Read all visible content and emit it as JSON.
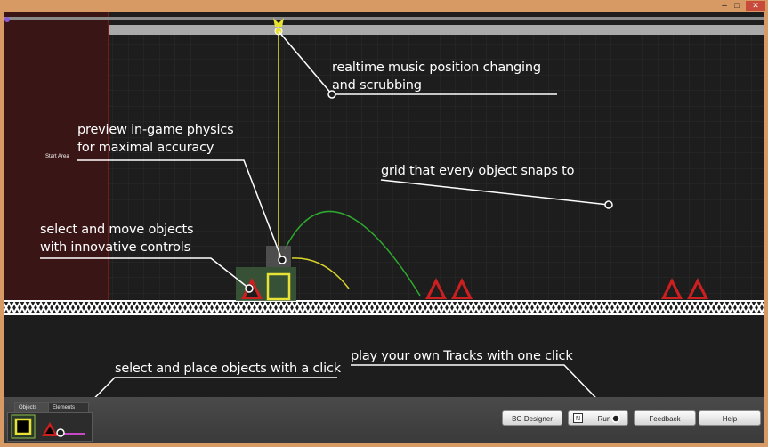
{
  "window": {
    "minimize_glyph": "–",
    "maximize_glyph": "□",
    "close_glyph": "✕"
  },
  "canvas": {
    "start_area_label": "Start Area",
    "annotations": {
      "music": "realtime music position changing\nand scrubbing",
      "physics": "preview in-game physics\nfor maximal accuracy",
      "grid": "grid that every object snaps to",
      "move": "select and move objects\nwith innovative controls",
      "place": "select and place objects with a click",
      "play": "play your own Tracks with one click"
    }
  },
  "bottombar": {
    "tabs": [
      {
        "label": "Objects"
      },
      {
        "label": "Elements"
      }
    ],
    "buttons": {
      "bg_designer": "BG Designer",
      "run": "Run",
      "feedback": "Feedback",
      "help": "Help"
    }
  },
  "colors": {
    "accent_yellow": "#e8e234",
    "spike_red": "#cc1f1f",
    "arc_green": "#2fa82f",
    "start_area": "#3a1414"
  },
  "icons": [
    "playhead-icon",
    "spike-icon",
    "block-icon",
    "run-icon"
  ]
}
